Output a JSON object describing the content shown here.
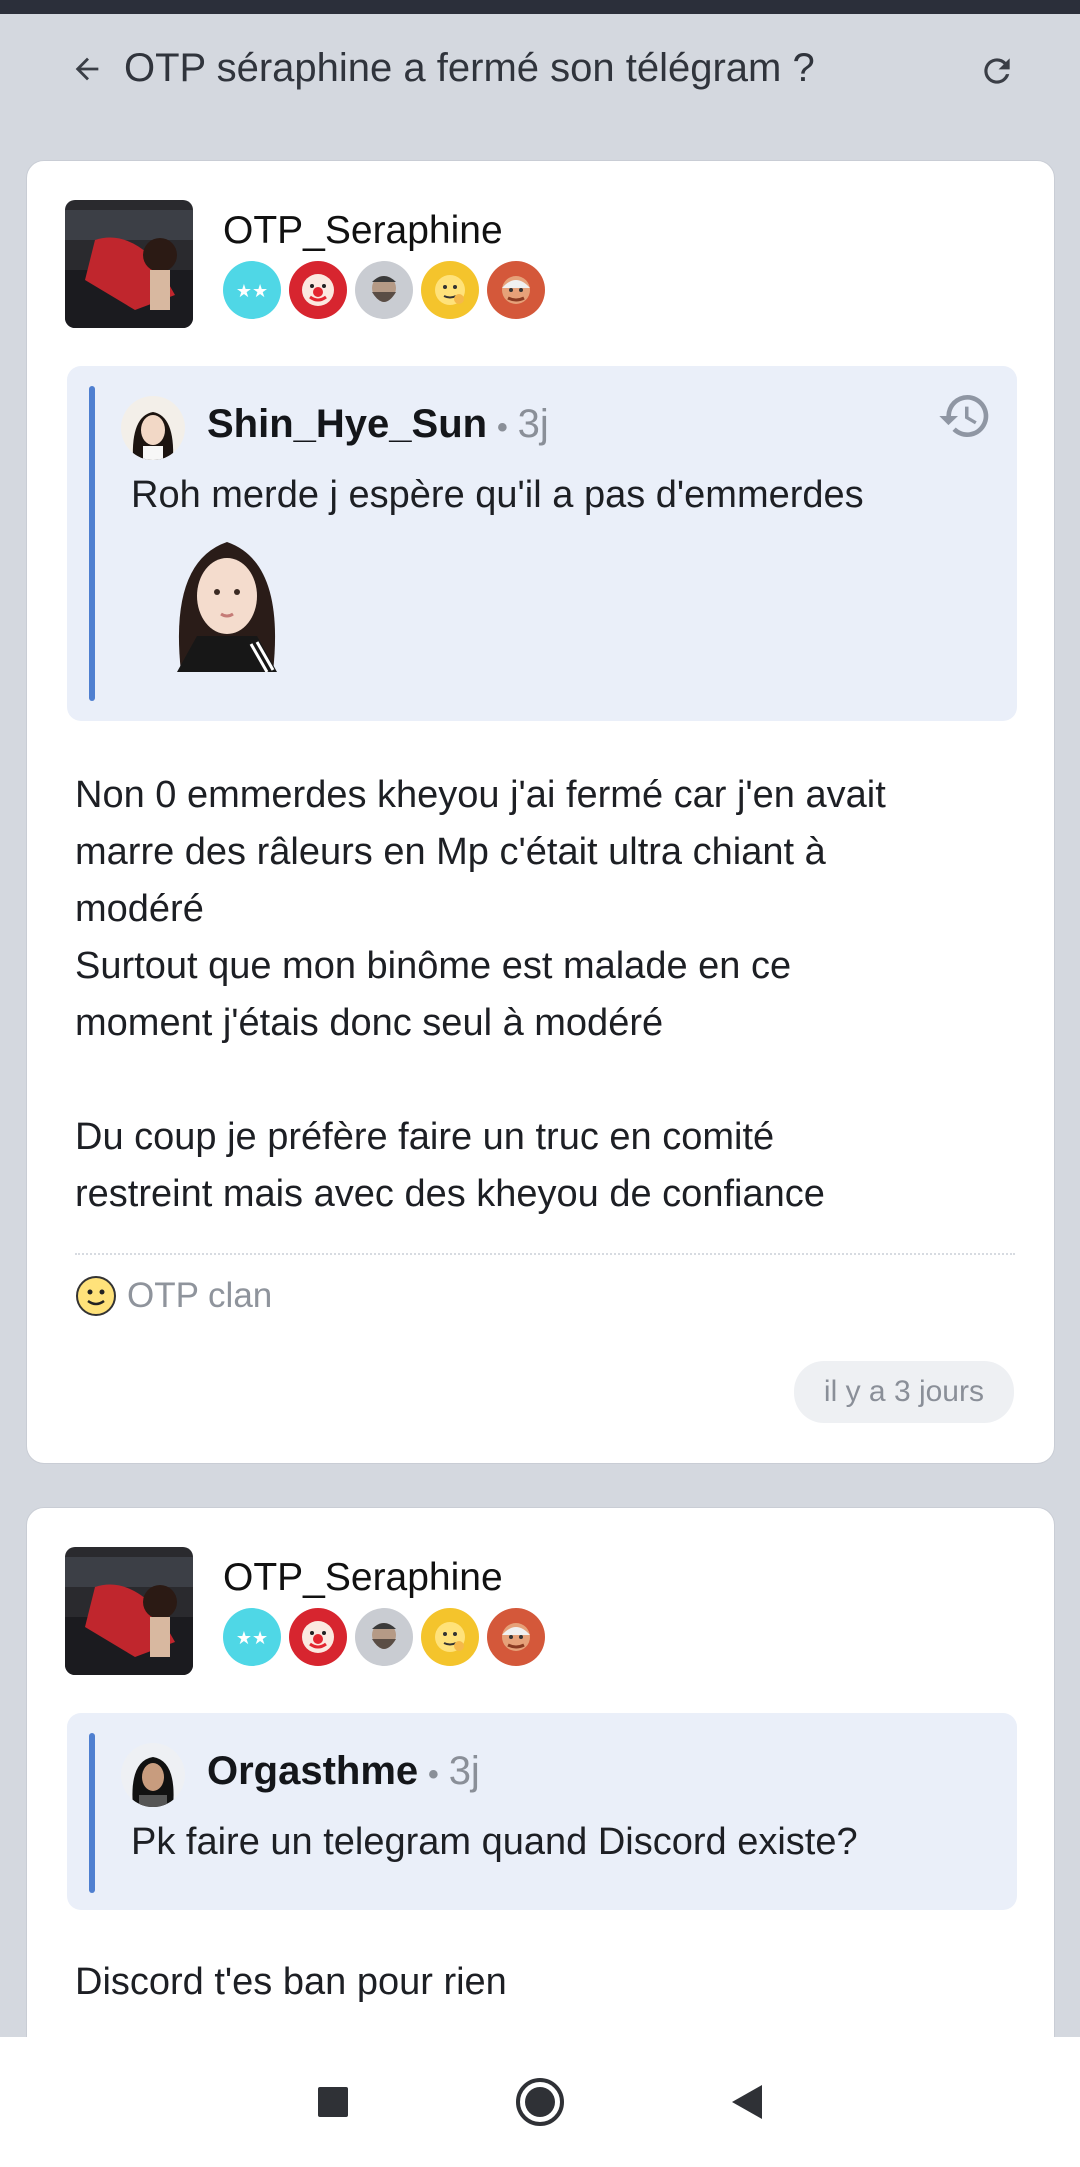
{
  "topbar": {
    "title": "OTP séraphine a fermé son télégram ?"
  },
  "posts": [
    {
      "author": "OTP_Seraphine",
      "badges": [
        "stars-badge",
        "clown-badge",
        "bearded-man-badge",
        "thinking-face-badge",
        "old-man-badge"
      ],
      "quote": {
        "author": "Shin_Hye_Sun",
        "separator": "•",
        "time": "3j",
        "text": "Roh merde j espère qu'il a pas d'emmerdes"
      },
      "body_lines": [
        "Non 0 emmerdes kheyou j'ai fermé car j'en avait",
        "marre des râleurs en Mp c'était ultra chiant à",
        "modéré",
        "Surtout que mon binôme est malade en ce",
        "moment j'étais donc seul à modéré",
        "",
        "Du coup je préfère faire un truc en comité",
        "restreint mais avec des kheyou de confiance"
      ],
      "signature": "OTP clan",
      "date": "il y a 3 jours"
    },
    {
      "author": "OTP_Seraphine",
      "badges": [
        "stars-badge",
        "clown-badge",
        "bearded-man-badge",
        "thinking-face-badge",
        "old-man-badge"
      ],
      "quote": {
        "author": "Orgasthme",
        "separator": "•",
        "time": "3j",
        "text": "Pk faire un telegram quand Discord existe?"
      },
      "body_lines": [
        "Discord t'es ban pour rien"
      ]
    }
  ],
  "colors": {
    "background": "#d4d8df",
    "quote_bg": "#eaeff9",
    "quote_bar": "#4f7fd0"
  }
}
